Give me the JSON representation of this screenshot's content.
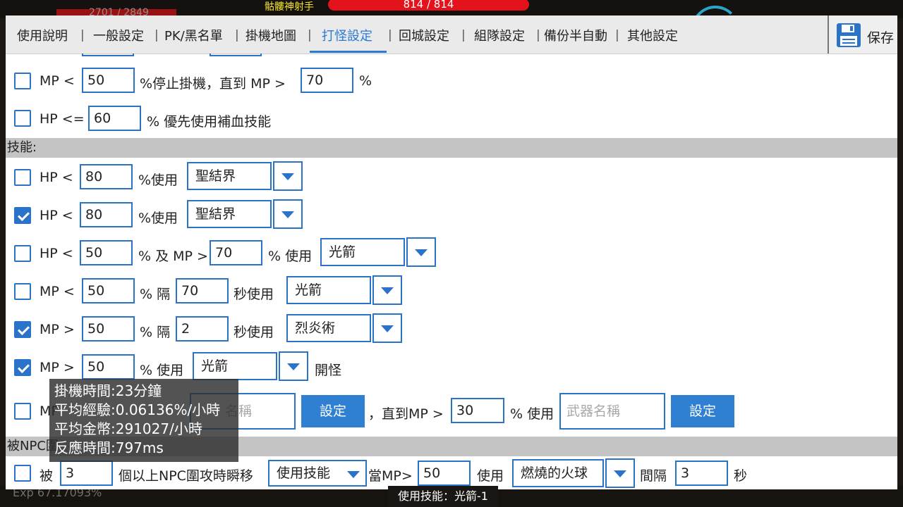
{
  "game": {
    "hp_text": "2701 / 2849",
    "target_name": "骷髏神射手",
    "target_hp": "814 / 814",
    "exp_text": "Exp 67.17093%",
    "skill_used": "使用技能：光箭-1"
  },
  "tabs": [
    "使用說明",
    "一般設定",
    "PK/黑名單",
    "掛機地圖",
    "打怪設定",
    "回城設定",
    "組隊設定",
    "備份半自動",
    "其他設定"
  ],
  "active_tab": "打怪設定",
  "save_label": "保存",
  "mp_stop": {
    "l1": "MP <",
    "v1": "50",
    "l2": "%停止掛機，直到 MP >",
    "v2": "70",
    "l3": "%"
  },
  "hp_heal": {
    "l1": "HP <=",
    "v1": "60",
    "l2": "% 優先使用補血技能"
  },
  "section_skill": "技能:",
  "skill_rows": [
    {
      "l1": "HP <",
      "v1": "80",
      "l2": "%使用",
      "skill": "聖結界"
    },
    {
      "l1": "HP <",
      "v1": "80",
      "l2": "%使用",
      "skill": "聖結界"
    },
    {
      "l1": "HP <",
      "v1": "50",
      "l2": "% 及 MP >",
      "v2": "70",
      "l3": "% 使用",
      "skill": "光箭"
    },
    {
      "l1": "MP <",
      "v1": "50",
      "l2": "% 隔",
      "v2": "70",
      "l3": "秒使用",
      "skill": "光箭"
    },
    {
      "l1": "MP >",
      "v1": "50",
      "l2": "% 隔",
      "v2": "2",
      "l3": "秒使用",
      "skill": "烈炎術"
    },
    {
      "l1": "MP >",
      "v1": "50",
      "l2": "% 使用",
      "skill": "光箭",
      "l3": "開怪"
    }
  ],
  "weapon_row": {
    "l1": "MP",
    "weapon_placeholder": "名稱",
    "set_label": "設定",
    "l2": "，直到MP >",
    "v2": "30",
    "l3": "% 使用",
    "weapon2_placeholder": "武器名稱",
    "set2_label": "設定"
  },
  "section_npc": "被NPC圍",
  "npc_row": {
    "l1": "被",
    "v1": "3",
    "l2": "個以上NPC圍攻時瞬移",
    "mode": "使用技能",
    "l3": "當MP>",
    "v2": "50",
    "l4": "使用",
    "skill": "燃燒的火球",
    "l5": "間隔",
    "v3": "3",
    "l6": "秒"
  },
  "stats": {
    "time": "掛機時間:23分鐘",
    "exp": "平均經驗:0.06136%/小時",
    "gold": "平均金幣:291027/小時",
    "reaction": "反應時間:797ms"
  },
  "colors": {
    "accent": "#2a73c9",
    "button": "#2f80d2",
    "section_bg": "#c4c4c4"
  }
}
